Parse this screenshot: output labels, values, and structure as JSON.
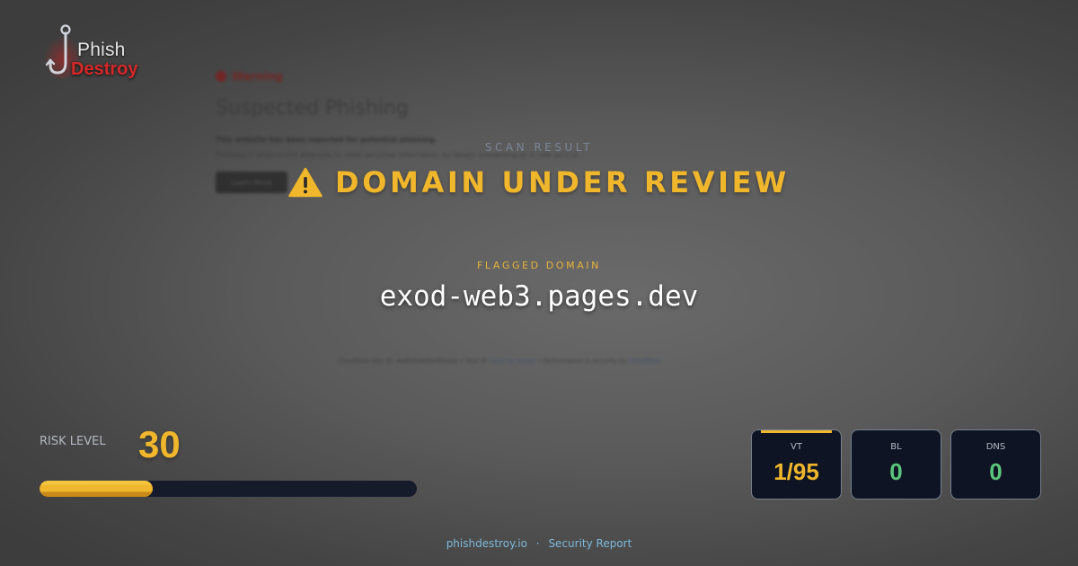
{
  "background_page": {
    "warning_label": "Warning",
    "title": "Suspected Phishing",
    "line1": "This website has been reported for potential phishing.",
    "line2": "Phishing is when a site attempts to steal sensitive information by falsely presenting as a safe source.",
    "button_label": "Learn More",
    "footer_prefix": "Cloudflare Ray ID: 8a8b8c8d9e9f0a1b",
    "footer_mid": "•  Your IP:",
    "footer_link1": "Click to reveal",
    "footer_mid2": "•  Performance & security by",
    "footer_link2": "Cloudflare"
  },
  "logo": {
    "line1": "Phish",
    "line2": "Destroy"
  },
  "scan": {
    "label": "SCAN RESULT",
    "status_icon": "warning-triangle-icon",
    "headline": "DOMAIN UNDER REVIEW"
  },
  "flagged": {
    "label": "FLAGGED DOMAIN",
    "domain": "exod-web3.pages.dev"
  },
  "risk": {
    "label": "RISK LEVEL",
    "value": "30",
    "fraction": 0.3
  },
  "stats": [
    {
      "label": "VT",
      "value": "1/95",
      "color": "#f0b72c",
      "highlight": true
    },
    {
      "label": "BL",
      "value": "0",
      "color": "#5cc47a",
      "highlight": false
    },
    {
      "label": "DNS",
      "value": "0",
      "color": "#5cc47a",
      "highlight": false
    }
  ],
  "footer": {
    "site": "phishdestroy.io",
    "separator": "·",
    "report": "Security Report"
  },
  "colors": {
    "accent": "#f0b72c",
    "safe": "#5cc47a",
    "danger": "#d62828",
    "card_bg": "#0e1424"
  }
}
